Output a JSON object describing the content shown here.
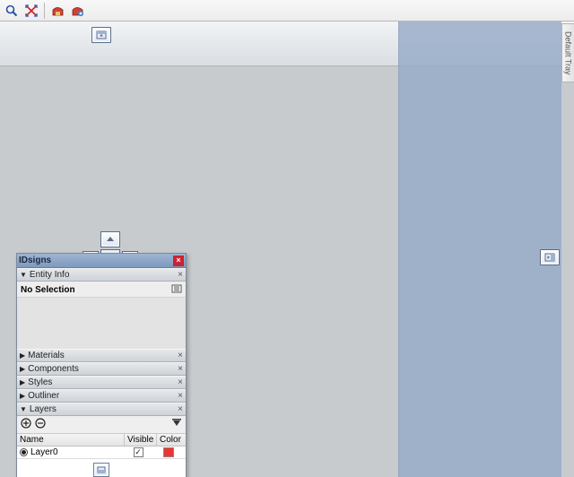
{
  "side_tab": "Default Tray",
  "tray": {
    "title": "IDsigns",
    "entity": {
      "header": "Entity Info",
      "no_selection": "No Selection"
    },
    "sections": {
      "materials": "Materials",
      "components": "Components",
      "styles": "Styles",
      "outliner": "Outliner",
      "layers": "Layers"
    },
    "layers": {
      "col_name": "Name",
      "col_visible": "Visible",
      "col_color": "Color",
      "rows": [
        {
          "name": "Layer0",
          "visible": true,
          "color": "#e33333"
        }
      ]
    }
  }
}
